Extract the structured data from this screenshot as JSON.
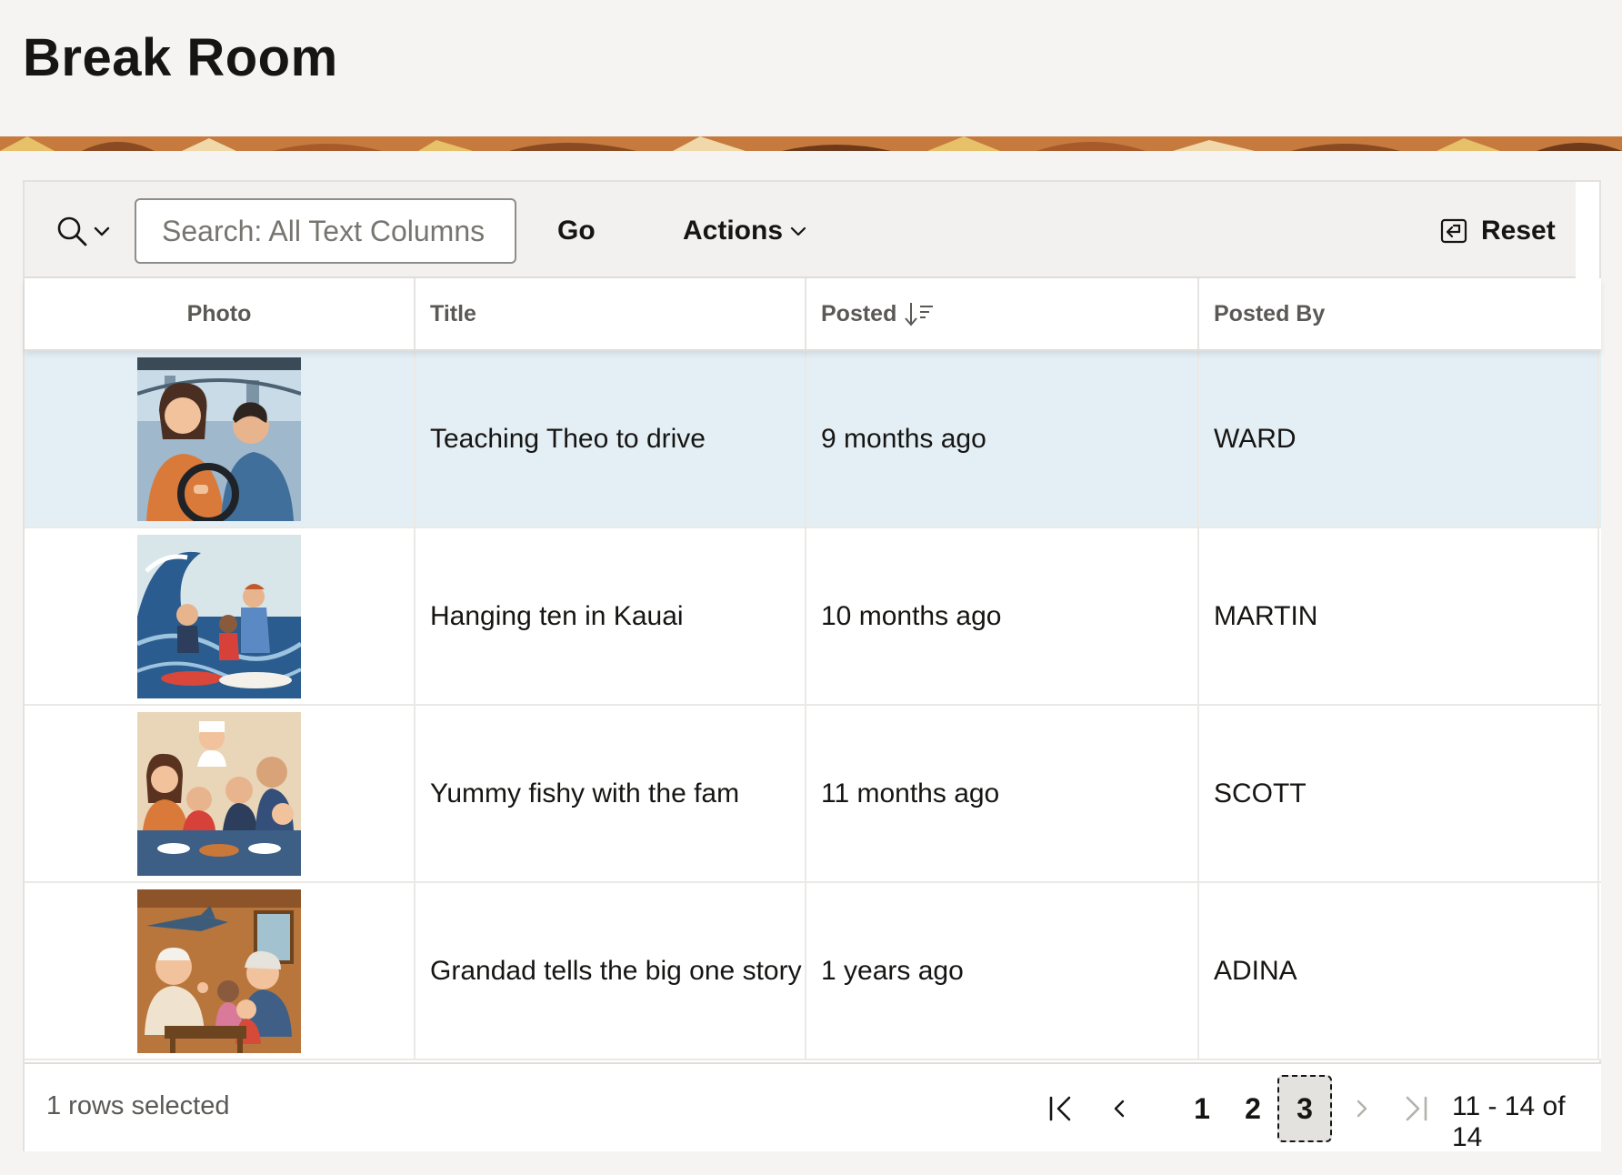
{
  "page": {
    "title": "Break Room"
  },
  "toolbar": {
    "search_placeholder": "Search: All Text Columns",
    "search_value": "",
    "go_label": "Go",
    "actions_label": "Actions",
    "reset_label": "Reset"
  },
  "table": {
    "headers": {
      "photo": "Photo",
      "title": "Title",
      "posted": "Posted",
      "posted_by": "Posted By"
    },
    "sort": {
      "column": "posted",
      "direction": "descending"
    },
    "rows": [
      {
        "title": "Teaching Theo to drive",
        "posted": "9 months ago",
        "posted_by": "WARD",
        "selected": true,
        "photo_icon": "driving-photo"
      },
      {
        "title": "Hanging ten in Kauai",
        "posted": "10 months ago",
        "posted_by": "MARTIN",
        "selected": false,
        "photo_icon": "surfing-photo"
      },
      {
        "title": "Yummy fishy with the fam",
        "posted": "11 months ago",
        "posted_by": "SCOTT",
        "selected": false,
        "photo_icon": "family-dinner-photo"
      },
      {
        "title": "Grandad tells the big one story",
        "posted": "1 years ago",
        "posted_by": "ADINA",
        "selected": false,
        "photo_icon": "fish-story-photo"
      }
    ]
  },
  "footer": {
    "rows_selected": "1 rows selected",
    "pages": [
      "1",
      "2",
      "3"
    ],
    "current_page": "3",
    "range": "11 - 14 of 14"
  },
  "colors": {
    "background": "#f5f4f2",
    "selected_row": "#e4eff5",
    "band": "#c77a3e",
    "text": "#161513"
  }
}
